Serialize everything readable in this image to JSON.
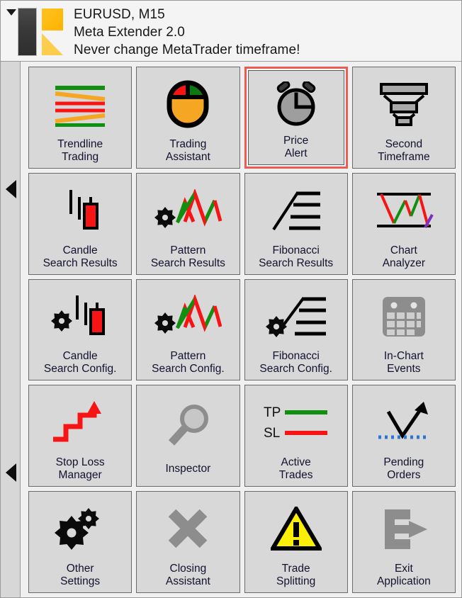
{
  "window": {
    "dropdown_icon": "caret-down-icon",
    "logo_icon": "meta-extender-logo"
  },
  "header": {
    "symbol_timeframe": "EURUSD, M15",
    "app_name": "Meta Extender 2.0",
    "warning": "Never change MetaTrader timeframe!"
  },
  "side_rail": {
    "scroll_left_top_icon": "triangle-left-icon",
    "scroll_left_bottom_icon": "triangle-left-icon"
  },
  "colors": {
    "selection_highlight": "#ee5b52",
    "tile_face": "#d8d8d8",
    "tile_border": "#6a6a6a",
    "window_bg": "#f0f0f0",
    "header_bg": "#f4f4f4",
    "rail_bg": "#d7d7d7",
    "label_text": "#121230",
    "bullish_green": "#109010",
    "bearish_red": "#f71414",
    "accent_orange": "#f5a623",
    "logo_yellow": "#ffc220",
    "warning_yellow": "#fbf005",
    "grey_icon": "#8d8d8d",
    "purple": "#7a31bf",
    "pending_blue": "#2e76d6"
  },
  "grid": {
    "columns": 4,
    "rows": 5,
    "tiles": [
      {
        "id": "trendline-trading",
        "label": "Trendline\nTrading",
        "icon": "trendlines-icon",
        "selected": false
      },
      {
        "id": "trading-assistant",
        "label": "Trading\nAssistant",
        "icon": "mouse-icon",
        "selected": false
      },
      {
        "id": "price-alert",
        "label": "Price\nAlert",
        "icon": "alarm-clock-icon",
        "selected": true
      },
      {
        "id": "second-timeframe",
        "label": "Second\nTimeframe",
        "icon": "funnel-stack-icon",
        "selected": false
      },
      {
        "id": "candle-search-results",
        "label": "Candle\nSearch Results",
        "icon": "candlestick-icon",
        "selected": false
      },
      {
        "id": "pattern-search-results",
        "label": "Pattern\nSearch Results",
        "icon": "zigzag-gear-icon",
        "selected": false
      },
      {
        "id": "fibonacci-search-results",
        "label": "Fibonacci\nSearch Results",
        "icon": "fibonacci-icon",
        "selected": false
      },
      {
        "id": "chart-analyzer",
        "label": "Chart\nAnalyzer",
        "icon": "chart-analyzer-icon",
        "selected": false
      },
      {
        "id": "candle-search-config",
        "label": "Candle\nSearch Config.",
        "icon": "candlestick-gear-icon",
        "selected": false
      },
      {
        "id": "pattern-search-config",
        "label": "Pattern\nSearch Config.",
        "icon": "zigzag-gear-icon",
        "selected": false
      },
      {
        "id": "fibonacci-search-config",
        "label": "Fibonacci\nSearch Config.",
        "icon": "fibonacci-gear-icon",
        "selected": false
      },
      {
        "id": "in-chart-events",
        "label": "In-Chart\nEvents",
        "icon": "calendar-icon",
        "selected": false
      },
      {
        "id": "stop-loss-manager",
        "label": "Stop Loss\nManager",
        "icon": "staircase-arrow-icon",
        "selected": false
      },
      {
        "id": "inspector",
        "label": "Inspector",
        "icon": "magnifier-icon",
        "selected": false
      },
      {
        "id": "active-trades",
        "label": "Active\nTrades",
        "icon": "tp-sl-lines-icon",
        "selected": false
      },
      {
        "id": "pending-orders",
        "label": "Pending\nOrders",
        "icon": "pending-arrow-icon",
        "selected": false
      },
      {
        "id": "other-settings",
        "label": "Other\nSettings",
        "icon": "gears-icon",
        "selected": false
      },
      {
        "id": "closing-assistant",
        "label": "Closing\nAssistant",
        "icon": "cross-icon",
        "selected": false
      },
      {
        "id": "trade-splitting",
        "label": "Trade\nSplitting",
        "icon": "warning-triangle-icon",
        "selected": false
      },
      {
        "id": "exit-application",
        "label": "Exit\nApplication",
        "icon": "exit-icon",
        "selected": false
      }
    ]
  },
  "icon_text": {
    "take_profit_abbr": "TP",
    "stop_loss_abbr": "SL",
    "warning_mark": "!"
  }
}
